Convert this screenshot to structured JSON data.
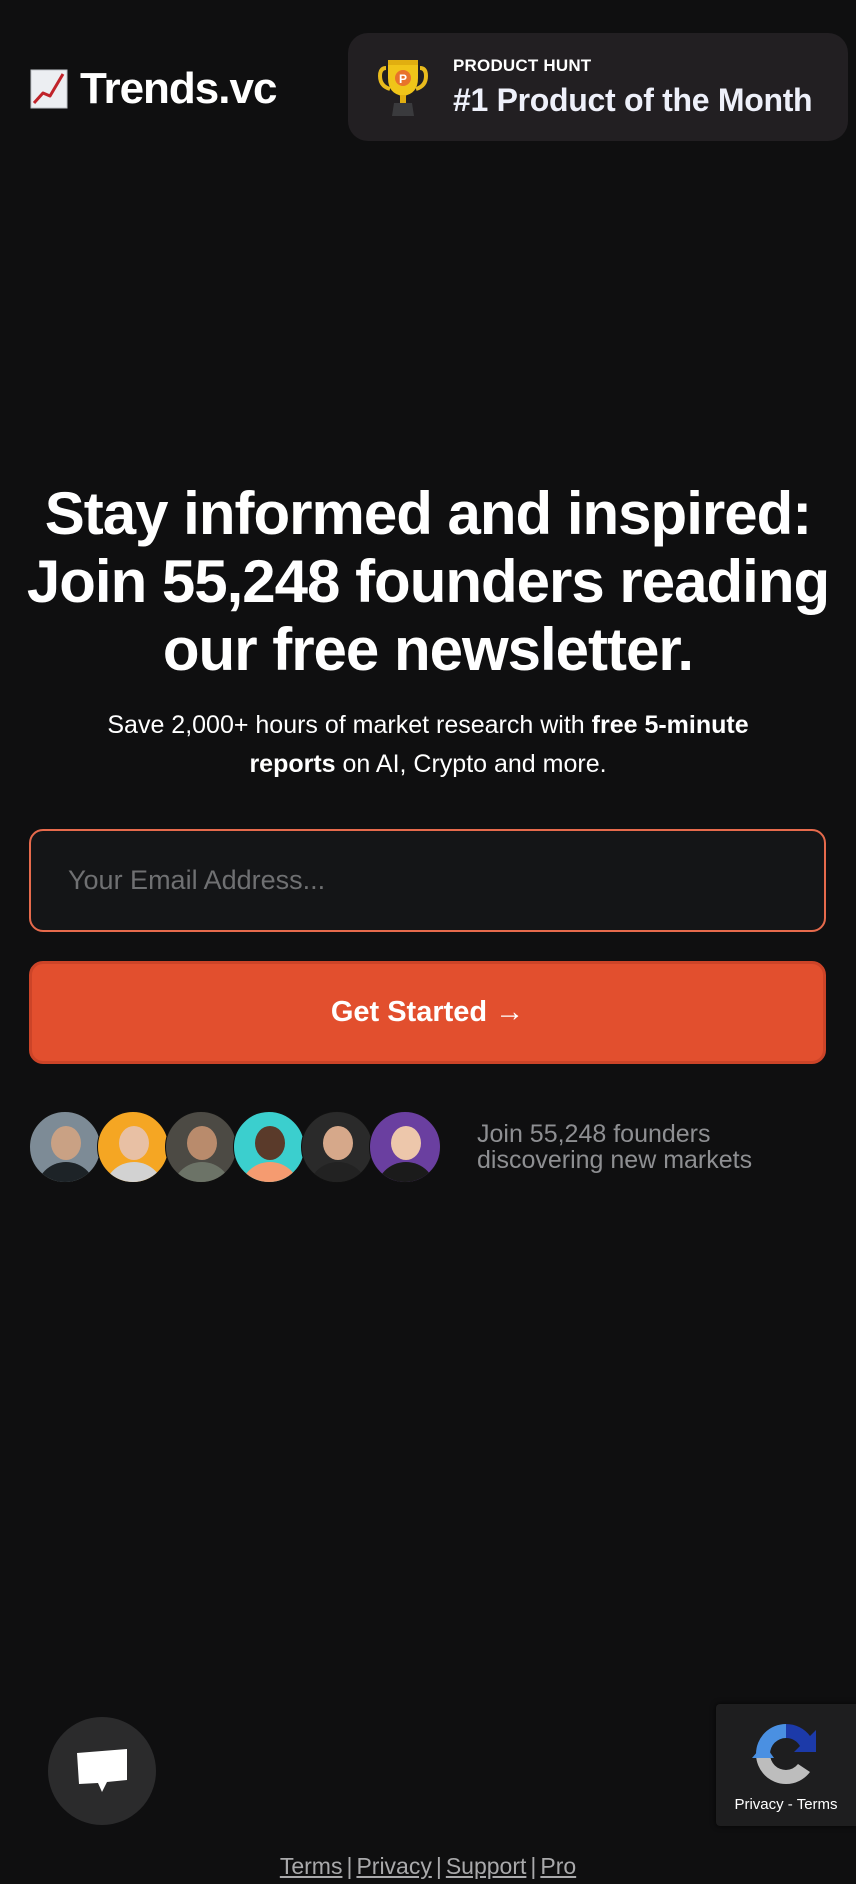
{
  "header": {
    "logo_text": "Trends.vc",
    "logo_icon": "chart-increasing-icon",
    "badge": {
      "icon": "trophy-icon",
      "label": "PRODUCT HUNT",
      "title": "#1 Product of the Month"
    }
  },
  "hero": {
    "headline": "Stay informed and inspired: Join 55,248 founders reading our free newsletter.",
    "subhead_prefix": "Save 2,000+ hours of market research with ",
    "subhead_bold": "free 5-minute reports",
    "subhead_suffix": " on AI, Crypto and more."
  },
  "form": {
    "email_placeholder": "Your Email Address...",
    "email_value": "",
    "submit_label": "Get Started →"
  },
  "social_proof": {
    "avatars": [
      {
        "name": "avatar-1",
        "bg": "#7d8b96",
        "skin": "#c9a184",
        "shirt": "#1d2327"
      },
      {
        "name": "avatar-2",
        "bg": "#f5a623",
        "skin": "#e8c0a4",
        "shirt": "#d2d2d2"
      },
      {
        "name": "avatar-3",
        "bg": "#4c4a44",
        "skin": "#b98b6c",
        "shirt": "#6c7367"
      },
      {
        "name": "avatar-4",
        "bg": "#3bcfce",
        "skin": "#5a3a2a",
        "shirt": "#f59b70"
      },
      {
        "name": "avatar-5",
        "bg": "#2a2a2a",
        "skin": "#d6a88a",
        "shirt": "#222222"
      },
      {
        "name": "avatar-6",
        "bg": "#6a3fa0",
        "skin": "#edc7ab",
        "shirt": "#1b1b1b"
      }
    ],
    "text_line1": "Join 55,248 founders",
    "text_line2": "discovering new markets"
  },
  "widgets": {
    "chat_icon": "chat-bubble-icon",
    "recaptcha_icon": "recaptcha-icon",
    "recaptcha_privacy": "Privacy",
    "recaptcha_sep": " - ",
    "recaptcha_terms": "Terms"
  },
  "footer": {
    "links": [
      "Terms",
      "Privacy",
      "Support",
      "Pro"
    ],
    "separator": "|"
  },
  "colors": {
    "background": "#0f0f10",
    "accent": "#e24f2e",
    "badge_bg": "#221f22",
    "input_border": "#e66a4c"
  }
}
